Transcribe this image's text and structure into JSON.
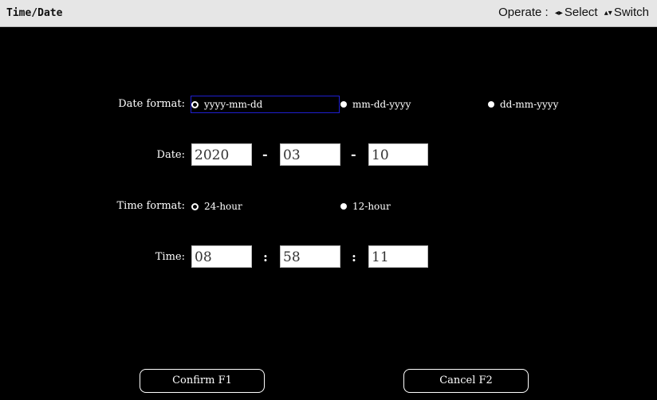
{
  "window": {
    "title": "Time/Date",
    "hint_operate": "Operate :",
    "hint_select": "Select",
    "hint_switch": "Switch",
    "select_icon": "left-right-arrows-icon",
    "switch_icon": "up-down-arrows-icon"
  },
  "date_format": {
    "label": "Date format:",
    "options": [
      "yyyy-mm-dd",
      "mm-dd-yyyy",
      "dd-mm-yyyy"
    ],
    "selected": "yyyy-mm-dd"
  },
  "date": {
    "label": "Date:",
    "year": "2020",
    "month": "03",
    "day": "10",
    "separator": "-"
  },
  "time_format": {
    "label": "Time format:",
    "options": [
      "24-hour",
      "12-hour"
    ],
    "selected": "24-hour"
  },
  "time": {
    "label": "Time:",
    "hour": "08",
    "minute": "58",
    "second": "11",
    "separator": ":"
  },
  "buttons": {
    "confirm": "Confirm F1",
    "cancel": "Cancel F2"
  },
  "colors": {
    "background": "#000000",
    "titlebar": "#e6e6e6",
    "focus": "#1f1fd0"
  }
}
